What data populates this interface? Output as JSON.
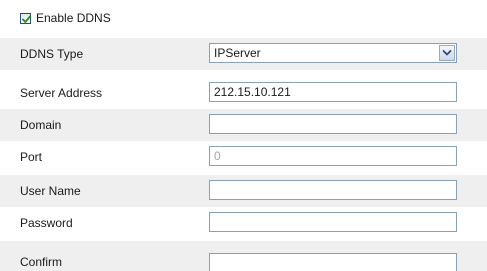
{
  "enable_ddns": {
    "label": "Enable DDNS",
    "checked": true
  },
  "fields": {
    "ddns_type": {
      "label": "DDNS Type",
      "value": "IPServer"
    },
    "server_address": {
      "label": "Server Address",
      "value": "212.15.10.121"
    },
    "domain": {
      "label": "Domain",
      "value": ""
    },
    "port": {
      "label": "Port",
      "value": "0"
    },
    "user_name": {
      "label": "User Name",
      "value": ""
    },
    "password": {
      "label": "Password",
      "value": ""
    },
    "confirm": {
      "label": "Confirm",
      "value": ""
    }
  },
  "colors": {
    "row_alt_bg": "#efefef",
    "input_border": "#8aa0b4",
    "disabled_text": "#a6a6a6",
    "checkmark": "#2a8a1e"
  }
}
